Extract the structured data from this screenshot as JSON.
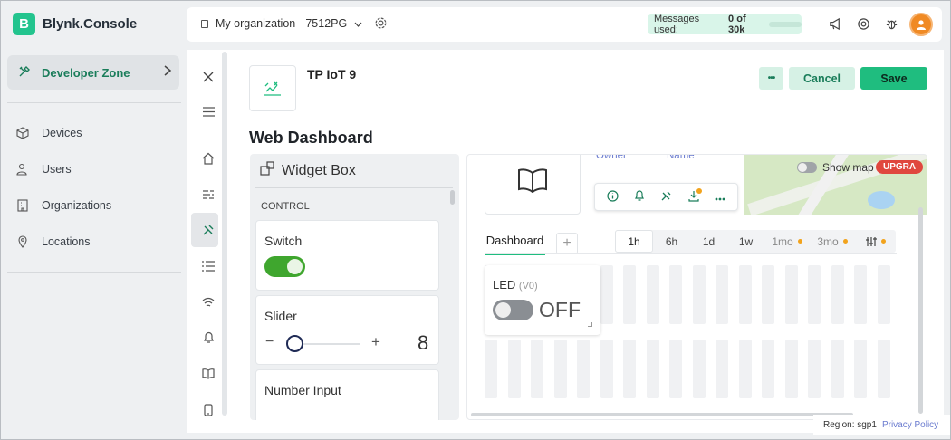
{
  "app": {
    "logo_letter": "B",
    "name": "Blynk.Console",
    "brand_color": "#23c48e"
  },
  "sidebar": {
    "developer_zone": "Developer Zone",
    "items": [
      {
        "label": "Devices",
        "icon": "cube-icon"
      },
      {
        "label": "Users",
        "icon": "users-icon"
      },
      {
        "label": "Organizations",
        "icon": "building-icon"
      },
      {
        "label": "Locations",
        "icon": "map-pin-icon"
      }
    ]
  },
  "header": {
    "organization": "My organization - 7512PG",
    "messages_label": "Messages used:",
    "messages_value": "0 of 30k"
  },
  "template": {
    "name": "TP IoT 9",
    "more_label": "•••",
    "cancel_label": "Cancel",
    "save_label": "Save"
  },
  "page": {
    "title": "Web Dashboard"
  },
  "widget_box": {
    "title": "Widget Box",
    "section": "CONTROL",
    "widgets": [
      {
        "title": "Switch"
      },
      {
        "title": "Slider",
        "minus": "−",
        "plus": "+",
        "value": "8"
      },
      {
        "title": "Number Input"
      }
    ]
  },
  "dashboard": {
    "owner_label": "Owner",
    "name_label": "Name",
    "show_map": "Show map",
    "upgrade": "UPGRA",
    "tab": "Dashboard",
    "add_tab": "+",
    "ranges": [
      "1h",
      "6h",
      "1d",
      "1w",
      "1mo",
      "3mo"
    ],
    "active_range": "1h",
    "led_widget": {
      "title": "LED",
      "pin": "(V0)",
      "state": "OFF"
    }
  },
  "footer": {
    "region": "Region: sgp1",
    "privacy": "Privacy Policy"
  },
  "colors": {
    "accent": "#1fbd7f",
    "switch_on": "#3fa62e",
    "link": "#6a7bcf",
    "upgrade": "#e0473e"
  }
}
